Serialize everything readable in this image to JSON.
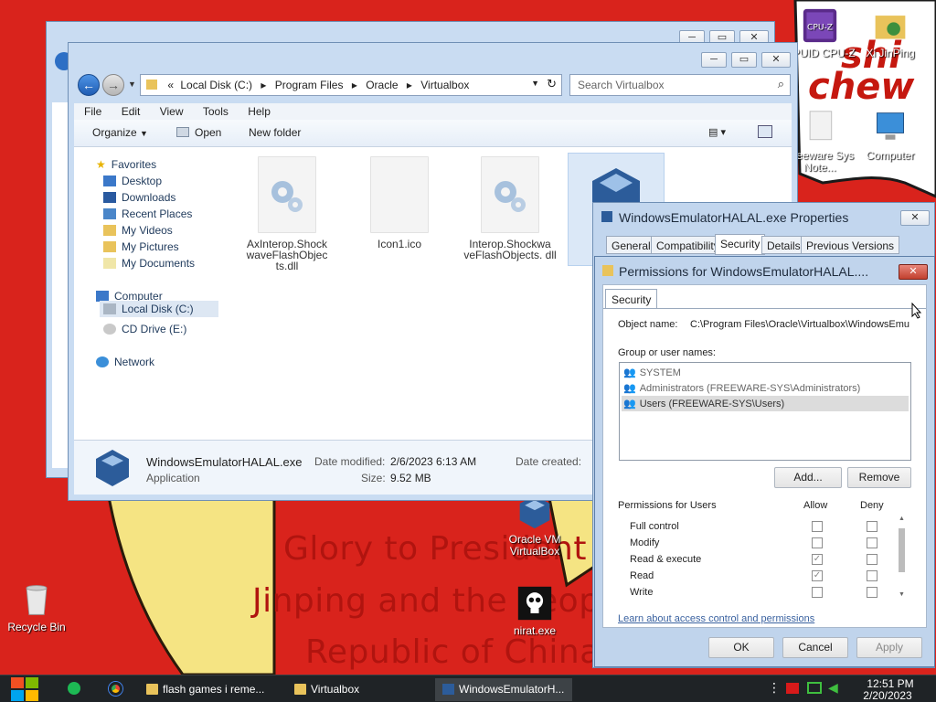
{
  "desktop": {
    "wall_lines": [
      "Glory to President Xi",
      "Jinping and the People's",
      "Republic of China"
    ],
    "wall_chinese": "shi",
    "wall_chinese2": "chew",
    "icons": [
      {
        "label": "CPUID CPU-Z",
        "glyph": "CPU-Z"
      },
      {
        "label": "Xi JinPing"
      },
      {
        "label": "Freeware Sys Note..."
      },
      {
        "label": "Computer"
      },
      {
        "label": "Oracle VM VirtualBox"
      },
      {
        "label": "nirat.exe"
      },
      {
        "label": "Recycle Bin"
      }
    ]
  },
  "explorer": {
    "breadcrumb": [
      "«",
      "Local Disk (C:)",
      "Program Files",
      "Oracle",
      "Virtualbox"
    ],
    "search_placeholder": "Search Virtualbox",
    "menu": [
      "File",
      "Edit",
      "View",
      "Tools",
      "Help"
    ],
    "toolbar": {
      "organize": "Organize",
      "open": "Open",
      "new_folder": "New folder"
    },
    "nav": {
      "favorites": "Favorites",
      "favorite_items": [
        "Desktop",
        "Downloads",
        "Recent Places",
        "My Videos",
        "My Pictures",
        "My Documents"
      ],
      "computer": "Computer",
      "computer_items": [
        "Local Disk (C:)",
        "CD Drive (E:)"
      ],
      "network": "Network"
    },
    "files": [
      {
        "name": "AxInterop.Shock waveFlashObjec ts.dll"
      },
      {
        "name": "Icon1.ico"
      },
      {
        "name": "Interop.Shockwa veFlashObjects. dll"
      },
      {
        "name": "Wi... r..."
      }
    ],
    "details": {
      "name": "WindowsEmulatorHALAL.exe",
      "type": "Application",
      "modified_label": "Date modified:",
      "modified_value": "2/6/2023 6:13 AM",
      "size_label": "Size:",
      "size_value": "9.52 MB",
      "created_label": "Date created:"
    }
  },
  "properties": {
    "title": "WindowsEmulatorHALAL.exe Properties",
    "tabs": [
      "General",
      "Compatibility",
      "Security",
      "Details",
      "Previous Versions"
    ]
  },
  "permissions": {
    "title": "Permissions for WindowsEmulatorHALAL....",
    "tab": "Security",
    "object_label": "Object name:",
    "object_value": "C:\\Program Files\\Oracle\\Virtualbox\\WindowsEmula",
    "group_label": "Group or user names:",
    "users": [
      "SYSTEM",
      "Administrators (FREEWARE-SYS\\Administrators)",
      "Users (FREEWARE-SYS\\Users)"
    ],
    "add_button": "Add...",
    "remove_button": "Remove",
    "perm_header": "Permissions for Users",
    "allow_header": "Allow",
    "deny_header": "Deny",
    "perms": [
      {
        "name": "Full control",
        "allow": false,
        "deny": false
      },
      {
        "name": "Modify",
        "allow": false,
        "deny": false
      },
      {
        "name": "Read & execute",
        "allow": true,
        "deny": false
      },
      {
        "name": "Read",
        "allow": true,
        "deny": false
      },
      {
        "name": "Write",
        "allow": false,
        "deny": false
      }
    ],
    "link": "Learn about access control and permissions",
    "ok": "OK",
    "cancel": "Cancel",
    "apply": "Apply"
  },
  "taskbar": {
    "items": [
      "flash games i reme...",
      "Virtualbox",
      "WindowsEmulatorH..."
    ],
    "time": "12:51 PM",
    "date": "2/20/2023"
  }
}
